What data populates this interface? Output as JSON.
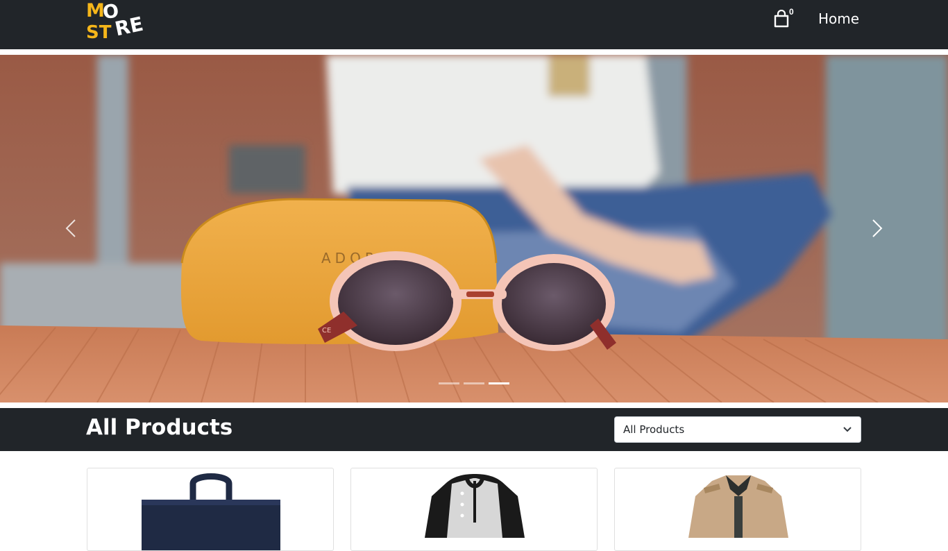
{
  "brand": {
    "logo_text": "MO ST RE"
  },
  "nav": {
    "cart_count": "0",
    "home_label": "Home"
  },
  "carousel": {
    "slide_alt": "Sunglasses on a yellow case on a wooden bench",
    "case_text": "ADORE",
    "active_index": 2,
    "indicators": 3
  },
  "products": {
    "title": "All Products",
    "filter": {
      "selected": "All Products"
    },
    "items": [
      {
        "name": "bag",
        "image": "navy-tote-bag"
      },
      {
        "name": "shirt",
        "image": "raglan-henley-shirt"
      },
      {
        "name": "jacket",
        "image": "khaki-jacket"
      }
    ]
  },
  "colors": {
    "navbar": "#212529",
    "logo_yellow": "#f5b61a",
    "white": "#ffffff"
  }
}
